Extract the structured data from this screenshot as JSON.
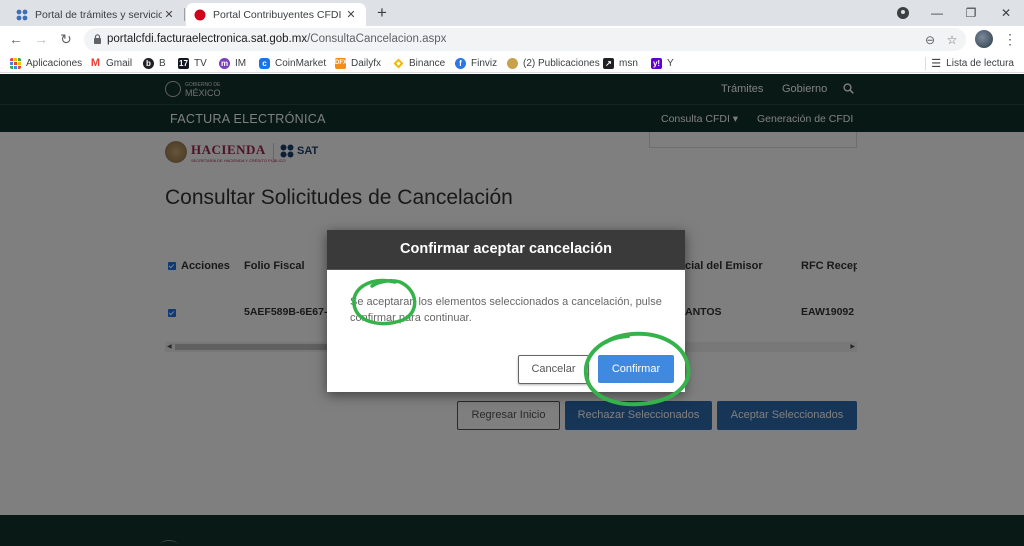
{
  "browser": {
    "tabs": [
      {
        "title": "Portal de trámites y servicios - SAT",
        "close": "✕"
      },
      {
        "title": "Portal Contribuyentes CFDI | Cancelación",
        "close": "✕"
      }
    ],
    "new_tab": "+",
    "window_controls": {
      "minimize": "—",
      "maximize": "❐",
      "close": "✕"
    },
    "url_host": "portalcfdi.facturaelectronica.sat.gob.mx",
    "url_path": "/ConsultaCancelacion.aspx"
  },
  "bookmarks": [
    {
      "label": "Aplicaciones",
      "icon": "apps-grid-icon",
      "color": "#e8453c"
    },
    {
      "label": "Gmail",
      "icon": "gmail-icon",
      "color": "#ea4335"
    },
    {
      "label": "B",
      "icon": "b-logo-icon",
      "color": "#202124"
    },
    {
      "label": "TV",
      "icon": "tradingview-icon",
      "color": "#131722"
    },
    {
      "label": "IM",
      "icon": "im-icon",
      "color": "#7a3dbf"
    },
    {
      "label": "CoinMarket",
      "icon": "coinmarket-icon",
      "color": "#1a73e8"
    },
    {
      "label": "Dailyfx",
      "icon": "dailyfx-icon",
      "color": "#f28c1e"
    },
    {
      "label": "Binance",
      "icon": "binance-icon",
      "color": "#f0b90b"
    },
    {
      "label": "Finviz",
      "icon": "finviz-icon",
      "color": "#2b78e4"
    },
    {
      "label": "(2) Publicaciones",
      "icon": "publicaciones-icon",
      "color": "#c8a24a"
    },
    {
      "label": "msn",
      "icon": "msn-icon",
      "color": "#202124"
    },
    {
      "label": "Y",
      "icon": "yahoo-icon",
      "color": "#6001d2"
    }
  ],
  "reading_list": "Lista de lectura",
  "gov": {
    "logo_line1": "GOBIERNO DE",
    "logo_line2": "MÉXICO",
    "nav": [
      "Trámites",
      "Gobierno"
    ]
  },
  "fe": {
    "title": "FACTURA ELECTRÓNICA",
    "nav": [
      "Consulta CFDI ▾",
      "Generación de CFDI"
    ]
  },
  "logos": {
    "hacienda": "HACIENDA",
    "hacienda_sub": "SECRETARÍA DE HACIENDA Y CRÉDITO PÚBLICO",
    "sat": "SAT"
  },
  "page_title": "Consultar Solicitudes de Cancelación",
  "table": {
    "headers": [
      "Acciones",
      "Folio Fiscal",
      "cial del Emisor",
      "RFC Recept"
    ],
    "rows": [
      {
        "folio": "5AEF589B-6E67-",
        "emisor": "ANTOS",
        "rfc": "EAW19092"
      }
    ]
  },
  "buttons": {
    "regresar": "Regresar Inicio",
    "rechazar": "Rechazar Seleccionados",
    "aceptar": "Aceptar Seleccionados"
  },
  "modal": {
    "title": "Confirmar aceptar cancelación",
    "body": "Se aceptaran los elementos seleccionados a cancelación, pulse confirmar para continuar.",
    "cancel": "Cancelar",
    "confirm": "Confirmar"
  },
  "colors": {
    "gov_green": "#13322b",
    "sat_blue": "#2d6aae",
    "confirm_blue": "#3f8ae0",
    "annotation_green": "#36b24a"
  }
}
